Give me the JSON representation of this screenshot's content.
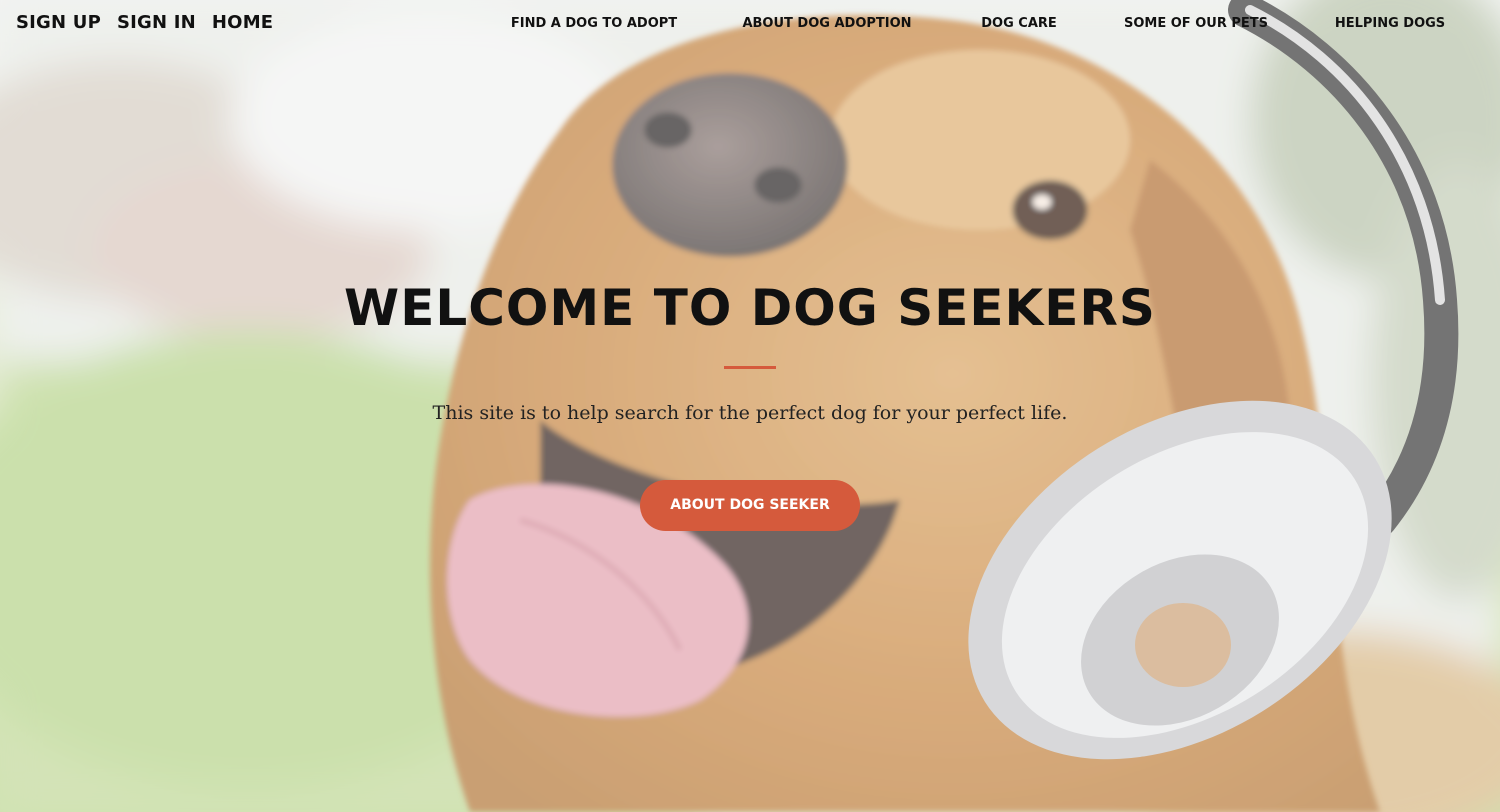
{
  "auth_nav": {
    "sign_up": "SIGN UP",
    "sign_in": "SIGN IN",
    "home": "HOME"
  },
  "main_nav": {
    "items": [
      {
        "label": "FIND A DOG TO ADOPT"
      },
      {
        "label": "ABOUT DOG ADOPTION"
      },
      {
        "label": "DOG CARE"
      },
      {
        "label": "SOME OF OUR PETS"
      },
      {
        "label": "HELPING DOGS"
      }
    ]
  },
  "hero": {
    "title": "WELCOME TO DOG SEEKERS",
    "subtitle": "This site is to help search for the perfect dog for your perfect life.",
    "cta_label": "ABOUT DOG SEEKER",
    "background_image": "golden-retriever-with-headphones"
  },
  "colors": {
    "accent": "#d55a3c",
    "text": "#111111"
  }
}
